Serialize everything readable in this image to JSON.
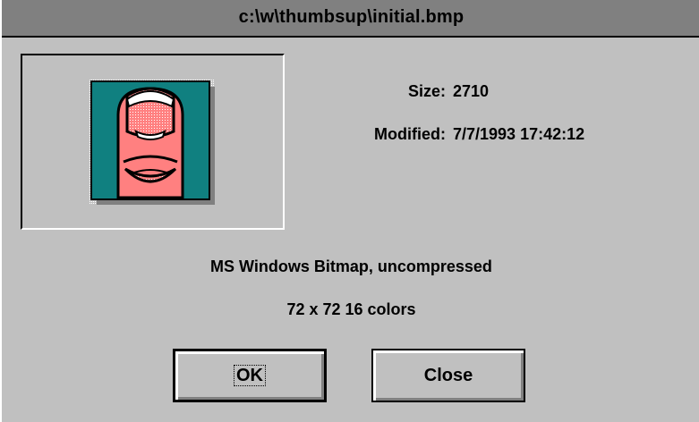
{
  "window": {
    "title": "c:\\w\\thumbsup\\initial.bmp"
  },
  "preview": {
    "icon": "thumbs-up-bitmap-icon"
  },
  "info": {
    "size_label": "Size:",
    "size_value": "2710",
    "modified_label": "Modified:",
    "modified_value": "7/7/1993 17:42:12",
    "format": "MS Windows Bitmap, uncompressed",
    "dimensions": "72 x 72  16 colors"
  },
  "buttons": {
    "ok_label": "OK",
    "close_label": "Close"
  },
  "colors": {
    "face": "#c0c0c0",
    "titlebar": "#808080",
    "thumb_bg": "#108080",
    "thumb_skin": "#ff8080"
  }
}
